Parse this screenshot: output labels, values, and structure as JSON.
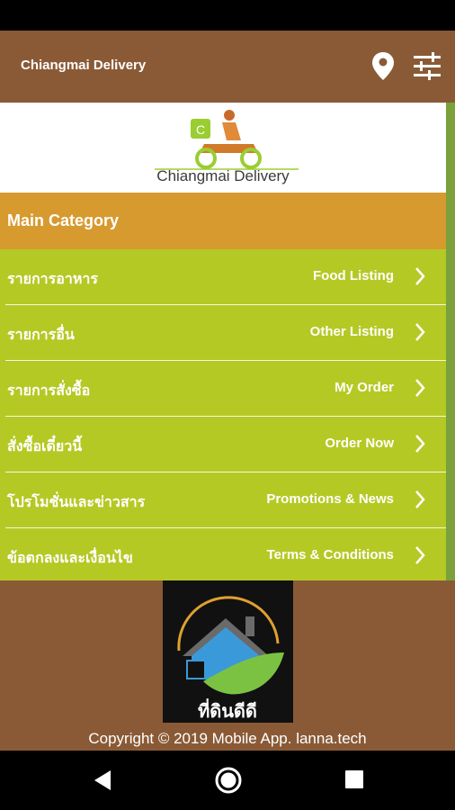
{
  "app_bar": {
    "title": "Chiangmai Delivery",
    "location_icon": "map-pin-icon",
    "filter_icon": "tune-sliders-icon"
  },
  "logo": {
    "text": "Chiangmai Delivery"
  },
  "main_category": {
    "label": "Main Category"
  },
  "menu": [
    {
      "thai": "รายการอาหาร",
      "english": "Food Listing"
    },
    {
      "thai": "รายการอื่น",
      "english": "Other Listing"
    },
    {
      "thai": "รายการสั่งซื้อ",
      "english": "My Order"
    },
    {
      "thai": "สั่งซื้อเดี๋ยวนี้",
      "english": "Order Now"
    },
    {
      "thai": "โปรโมชั่นและข่าวสาร",
      "english": "Promotions & News"
    },
    {
      "thai": "ข้อตกลงและเงื่อนไข",
      "english": "Terms & Conditions"
    }
  ],
  "footer": {
    "sponsor_logo_text": "ที่ดินดีดี",
    "copyright": "Copyright © 2019 Mobile App. lanna.tech"
  },
  "colors": {
    "brown": "#8a5a36",
    "orange": "#d79a2f",
    "lime": "#b5c925",
    "green_edge": "#7aa13a"
  }
}
